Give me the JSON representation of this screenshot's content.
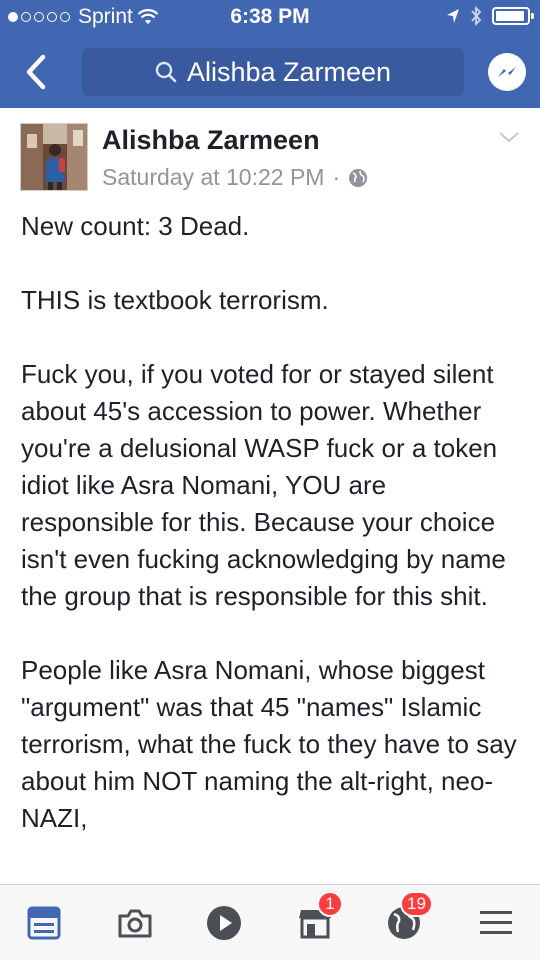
{
  "status_bar": {
    "carrier": "Sprint",
    "time": "6:38 PM"
  },
  "nav": {
    "search_text": "Alishba Zarmeen"
  },
  "post": {
    "author": "Alishba Zarmeen",
    "timestamp": "Saturday at 10:22 PM",
    "separator": "·",
    "paragraphs": [
      "New count: 3 Dead.",
      "THIS is textbook terrorism.",
      "Fuck you, if you voted for or stayed silent about 45's accession to power. Whether you're a delusional WASP fuck or a token idiot like Asra Nomani, YOU are responsible for this. Because your choice isn't even fucking acknowledging by name the group that is responsible for this shit.",
      "People like Asra Nomani, whose biggest \"argument\" was that 45 \"names\" Islamic terrorism, what the fuck to they have to say about him NOT naming the alt-right, neo-NAZI,"
    ]
  },
  "tab_bar": {
    "requests_badge": "1",
    "notifications_badge": "19"
  },
  "colors": {
    "brand": "#4267b2",
    "tab_active": "#4267b2",
    "tab_inactive": "#4b4f56",
    "badge": "#fa3e3e"
  }
}
